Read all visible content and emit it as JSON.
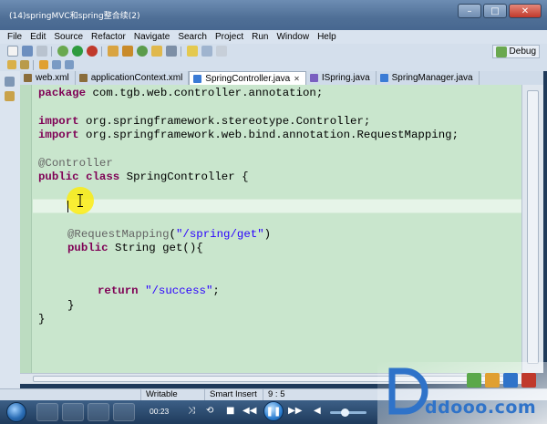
{
  "window": {
    "title": "(14)springMVC和spring整合续(2)",
    "controls": {
      "minimize": "–",
      "maximize": "□",
      "close": "✕"
    }
  },
  "menu": [
    "File",
    "Edit",
    "Source",
    "Refactor",
    "Navigate",
    "Search",
    "Project",
    "Run",
    "Window",
    "Help"
  ],
  "toolbar": {
    "perspective_label": "Debug",
    "icons": [
      "new-icon",
      "save-icon",
      "print-icon",
      "debug-icon",
      "run-icon",
      "external-tools-icon",
      "new-java-project-icon",
      "new-package-icon",
      "new-class-icon",
      "open-type-icon",
      "search-icon",
      "toggle-mark-occurrences-icon",
      "toggle-block-selection-icon",
      "show-whitespace-icon",
      "perspective-icon"
    ]
  },
  "tabs": [
    {
      "label": "web.xml",
      "icon": "xml-file-icon",
      "active": false,
      "color": "#8a6d3b"
    },
    {
      "label": "applicationContext.xml",
      "icon": "xml-file-icon",
      "active": false,
      "color": "#8a6d3b"
    },
    {
      "label": "SpringController.java",
      "icon": "java-file-icon",
      "active": true,
      "color": "#3a7bd5"
    },
    {
      "label": "ISpring.java",
      "icon": "java-interface-icon",
      "active": false,
      "color": "#7a5fc0"
    },
    {
      "label": "SpringManager.java",
      "icon": "java-file-icon",
      "active": false,
      "color": "#3a7bd5"
    }
  ],
  "code": {
    "package_kw": "package",
    "package_name": " com.tgb.web.controller.annotation;",
    "import_kw": "import",
    "import1": " org.springframework.stereotype.Controller;",
    "import2": " org.springframework.web.bind.annotation.RequestMapping;",
    "annotation_controller": "@Controller",
    "public_kw": "public",
    "class_kw": "class",
    "class_name": " SpringController {",
    "annotation_mapping": "@RequestMapping",
    "mapping_open": "(",
    "mapping_value": "\"/spring/get\"",
    "mapping_close": ")",
    "method_rest": " String get(){",
    "return_kw": "return",
    "return_value": "\"/success\"",
    "semicolon": ";",
    "close_brace": "}"
  },
  "status": {
    "mode": "Writable",
    "insert": "Smart Insert",
    "position": "9 : 5"
  },
  "player": {
    "time": "00:23",
    "play_pause_symbol": "❚❚"
  },
  "watermark": {
    "text": "ddooo.com"
  },
  "colors": {
    "editor_bg": "#c9e6cd",
    "keyword": "#7f0055",
    "annotation": "#646464",
    "string": "#2a00ff",
    "cursor_highlight": "#ffec00"
  }
}
